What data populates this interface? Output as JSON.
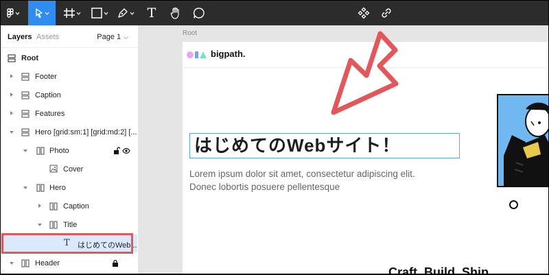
{
  "toolbar": {
    "tools": [
      {
        "name": "figma-menu-icon"
      },
      {
        "name": "move-tool-icon"
      },
      {
        "name": "frame-tool-icon"
      },
      {
        "name": "shape-tool-icon"
      },
      {
        "name": "pen-tool-icon"
      },
      {
        "name": "text-tool-icon",
        "glyph": "T"
      },
      {
        "name": "hand-tool-icon"
      },
      {
        "name": "comment-tool-icon"
      },
      {
        "name": "component-icon"
      },
      {
        "name": "link-icon"
      }
    ],
    "active_tool": "move-tool-icon",
    "active_color": "#2f8cf0"
  },
  "panel": {
    "tab_layers": "Layers",
    "tab_assets": "Assets",
    "page_select": "Page 1",
    "layers": [
      {
        "label": "Root"
      },
      {
        "label": "Footer"
      },
      {
        "label": "Caption"
      },
      {
        "label": "Features"
      },
      {
        "label": "Hero [grid:sm:1] [grid:md:2] [..."
      },
      {
        "label": "Photo"
      },
      {
        "label": "Cover"
      },
      {
        "label": "Hero"
      },
      {
        "label": "Caption"
      },
      {
        "label": "Title"
      },
      {
        "label": "はじめてのWeb..."
      },
      {
        "label": "Header"
      }
    ],
    "selected_layer": "はじめてのWeb...",
    "highlight_color": "#e5565a"
  },
  "canvas": {
    "root_label": "Root",
    "logo_text": "bigpath.",
    "hero_title": "はじめてのWebサイト！",
    "description_line1": "Lorem ipsum dolor sit amet, consectetur adipiscing elit.",
    "description_line2": "Donec lobortis posuere pellentesque",
    "bottom_text": "Craft. Build. Ship."
  }
}
